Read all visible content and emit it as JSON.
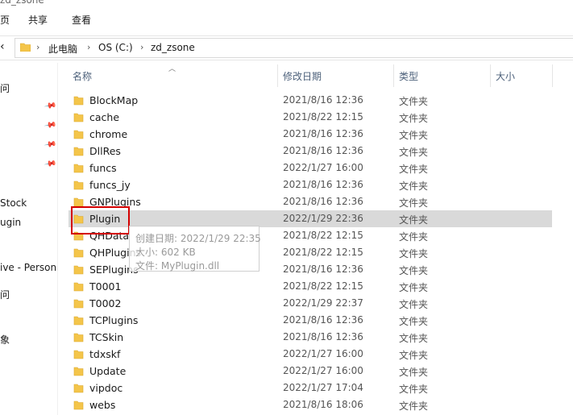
{
  "window": {
    "title_fragment": "zd_zsone"
  },
  "ribbon": {
    "tabs": [
      "页",
      "共享",
      "查看"
    ]
  },
  "address_bar": {
    "breadcrumbs": [
      "此电脑",
      "OS (C:)",
      "zd_zsone"
    ]
  },
  "nav_pane": {
    "items": [
      "问",
      "Stock",
      "ugin",
      "ive - Persona",
      "问",
      "象"
    ]
  },
  "columns": {
    "name": "名称",
    "date": "修改日期",
    "type": "类型",
    "size": "大小"
  },
  "files": [
    {
      "name": "BlockMap",
      "date": "2021/8/16 12:36",
      "type": "文件夹"
    },
    {
      "name": "cache",
      "date": "2021/8/22 12:15",
      "type": "文件夹"
    },
    {
      "name": "chrome",
      "date": "2021/8/16 12:36",
      "type": "文件夹"
    },
    {
      "name": "DllRes",
      "date": "2021/8/16 12:36",
      "type": "文件夹"
    },
    {
      "name": "funcs",
      "date": "2022/1/27 16:00",
      "type": "文件夹"
    },
    {
      "name": "funcs_jy",
      "date": "2021/8/16 12:36",
      "type": "文件夹"
    },
    {
      "name": "GNPlugins",
      "date": "2021/8/16 12:36",
      "type": "文件夹"
    },
    {
      "name": "Plugin",
      "date": "2022/1/29 22:36",
      "type": "文件夹",
      "selected": true
    },
    {
      "name": "QHData",
      "date": "2021/8/22 12:15",
      "type": "文件夹"
    },
    {
      "name": "QHPlugins",
      "date": "2021/8/22 12:15",
      "type": "文件夹"
    },
    {
      "name": "SEPlugins",
      "date": "2021/8/16 12:36",
      "type": "文件夹"
    },
    {
      "name": "T0001",
      "date": "2021/8/22 12:15",
      "type": "文件夹"
    },
    {
      "name": "T0002",
      "date": "2022/1/29 22:37",
      "type": "文件夹"
    },
    {
      "name": "TCPlugins",
      "date": "2021/8/16 12:36",
      "type": "文件夹"
    },
    {
      "name": "TCSkin",
      "date": "2021/8/16 12:36",
      "type": "文件夹"
    },
    {
      "name": "tdxskf",
      "date": "2022/1/27 16:00",
      "type": "文件夹"
    },
    {
      "name": "Update",
      "date": "2022/1/27 16:00",
      "type": "文件夹"
    },
    {
      "name": "vipdoc",
      "date": "2022/1/27 17:04",
      "type": "文件夹"
    },
    {
      "name": "webs",
      "date": "2021/8/16 18:06",
      "type": "文件夹"
    }
  ],
  "tooltip": {
    "created": "创建日期: 2022/1/29 22:35",
    "size": "大小: 602 KB",
    "files": "文件: MyPlugin.dll"
  },
  "colors": {
    "folder": "#f4c54a",
    "selection": "#d9d9d9",
    "highlight_box": "#d40000",
    "header_text": "#4c607a"
  },
  "icons": {
    "folder": "folder-icon",
    "pin": "pin-icon",
    "sort": "sort-up-icon"
  }
}
